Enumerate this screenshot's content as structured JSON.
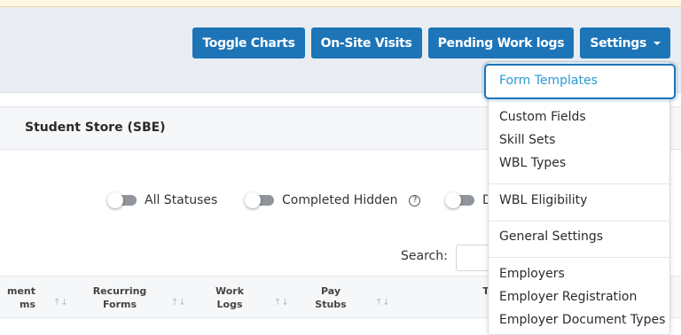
{
  "toolbar": {
    "toggle_charts": "Toggle Charts",
    "on_site_visits": "On-Site Visits",
    "pending_work_logs": "Pending Work logs",
    "settings": "Settings"
  },
  "card": {
    "title": "Student Store (SBE)"
  },
  "filters": {
    "all_statuses": "All Statuses",
    "completed_hidden": "Completed Hidden",
    "partial": "D",
    "help_glyph": "?"
  },
  "search": {
    "label": "Search:"
  },
  "table": {
    "headers": [
      {
        "line1": "ment",
        "line2": "ms"
      },
      {
        "line1": "Recurring",
        "line2": "Forms"
      },
      {
        "line1": "Work",
        "line2": "Logs"
      },
      {
        "line1": "Pay",
        "line2": "Stubs"
      },
      {
        "line1": "T",
        "line2": ""
      }
    ],
    "sort_glyph": "↑↓"
  },
  "settings_menu": {
    "items": [
      "Form Templates",
      "Custom Fields",
      "Skill Sets",
      "WBL Types",
      "WBL Eligibility",
      "General Settings",
      "Employers",
      "Employer Registration",
      "Employer Document Types"
    ]
  },
  "colors": {
    "primary": "#1d74b7",
    "active_link": "#2a9ad6",
    "background": "#e9edf2"
  }
}
